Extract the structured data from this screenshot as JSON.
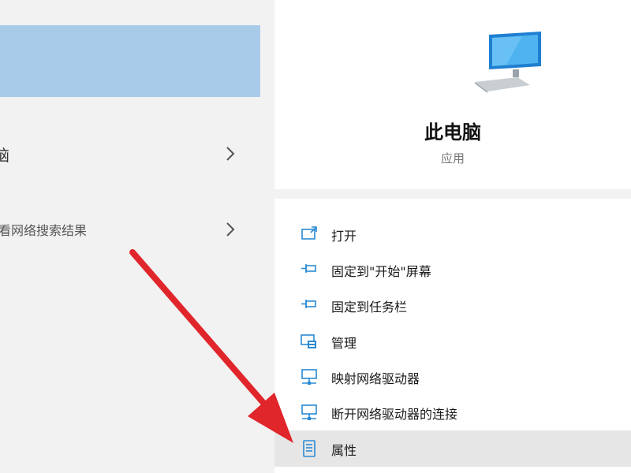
{
  "left": {
    "results": [
      {
        "label": "脑",
        "icon": "chevron-right-icon"
      },
      {
        "label": "看网络搜索结果",
        "icon": "chevron-right-icon"
      }
    ]
  },
  "preview": {
    "icon": "this-pc-monitor-icon",
    "title": "此电脑",
    "subtitle": "应用"
  },
  "actions": [
    {
      "label": "打开",
      "icon": "open-icon"
    },
    {
      "label": "固定到\"开始\"屏幕",
      "icon": "pin-icon"
    },
    {
      "label": "固定到任务栏",
      "icon": "pin-icon"
    },
    {
      "label": "管理",
      "icon": "manage-icon"
    },
    {
      "label": "映射网络驱动器",
      "icon": "network-drive-icon"
    },
    {
      "label": "断开网络驱动器的连接",
      "icon": "network-drive-icon"
    },
    {
      "label": "属性",
      "icon": "properties-icon"
    }
  ],
  "colors": {
    "highlight": "#a9cbea",
    "accent_blue": "#2a8ad4",
    "annotation_red": "#e0262b",
    "selected_row": "#e6e6e6"
  }
}
